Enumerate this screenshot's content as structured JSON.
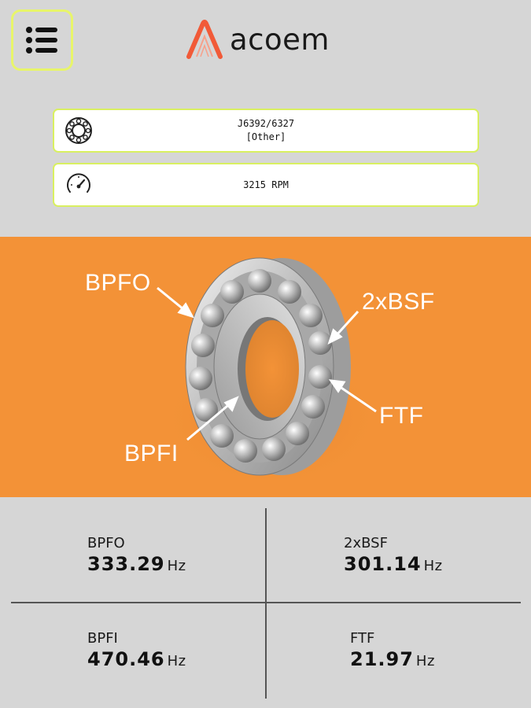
{
  "header": {
    "menu_icon": "list-icon",
    "brand": "acoem",
    "brand_color": "#f15a38"
  },
  "bearing_card": {
    "icon": "bearing-icon",
    "line1": "J6392/6327",
    "line2": "[Other]"
  },
  "speed_card": {
    "icon": "speedometer-icon",
    "text": "3215 RPM"
  },
  "diagram": {
    "background": "#f39237",
    "labels": {
      "bpfo": "BPFO",
      "bsf": "2xBSF",
      "ftf": "FTF",
      "bpfi": "BPFI"
    }
  },
  "results": [
    {
      "name": "BPFO",
      "value": "333.29",
      "unit": "Hz"
    },
    {
      "name": "2xBSF",
      "value": "301.14",
      "unit": "Hz"
    },
    {
      "name": "BPFI",
      "value": "470.46",
      "unit": "Hz"
    },
    {
      "name": "FTF",
      "value": "21.97",
      "unit": "Hz"
    }
  ]
}
